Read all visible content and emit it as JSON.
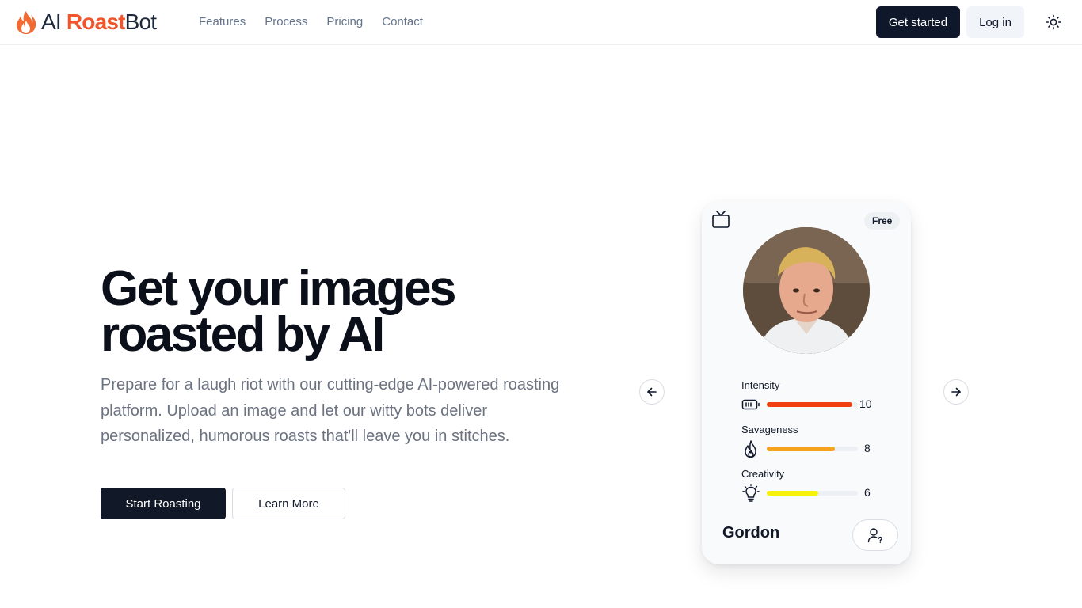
{
  "brand": {
    "ai": "AI",
    "roast": "Roast",
    "bot": "Bot",
    "accent": "#f0552b"
  },
  "nav": {
    "links": [
      "Features",
      "Process",
      "Pricing",
      "Contact"
    ],
    "get_started": "Get started",
    "login": "Log in",
    "theme_icon": "sun-icon"
  },
  "hero": {
    "title_line1": "Get your images",
    "title_line2": "roasted by AI",
    "description": "Prepare for a laugh riot with our cutting-edge AI-powered roasting platform. Upload an image and let our witty bots deliver personalized, humorous roasts that'll leave you in stitches.",
    "start_button": "Start Roasting",
    "learn_button": "Learn More"
  },
  "card": {
    "badge": "Free",
    "name": "Gordon",
    "stats": [
      {
        "label": "Intensity",
        "value": "10",
        "fraction": 1.0,
        "color": "#f0400f",
        "icon": "battery-icon"
      },
      {
        "label": "Savageness",
        "value": "8",
        "fraction": 0.8,
        "color": "#f5a21c",
        "icon": "flame-icon"
      },
      {
        "label": "Creativity",
        "value": "6",
        "fraction": 0.6,
        "color": "#f8f20a",
        "icon": "lightbulb-icon"
      }
    ]
  }
}
